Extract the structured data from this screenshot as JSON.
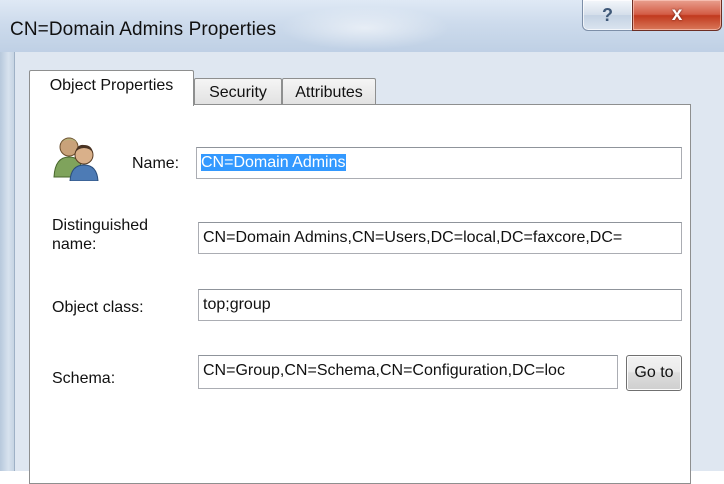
{
  "window": {
    "title": "CN=Domain Admins Properties",
    "help_glyph": "?",
    "close_glyph": "x"
  },
  "tabs": [
    {
      "label": "Object Properties",
      "active": true
    },
    {
      "label": "Security",
      "active": false
    },
    {
      "label": "Attributes",
      "active": false
    }
  ],
  "form": {
    "icon": "users-group-icon",
    "name_label": "Name:",
    "name_value": "CN=Domain Admins",
    "dn_label_line1": "Distinguished",
    "dn_label_line2": "name:",
    "dn_value": "CN=Domain Admins,CN=Users,DC=local,DC=faxcore,DC=",
    "class_label": "Object class:",
    "class_value": "top;group",
    "schema_label": "Schema:",
    "schema_value": "CN=Group,CN=Schema,CN=Configuration,DC=loc",
    "goto_label": "Go to"
  },
  "colors": {
    "selection": "#3399ff",
    "close_button": "#c1391e",
    "titlebar": "#cddbec"
  }
}
